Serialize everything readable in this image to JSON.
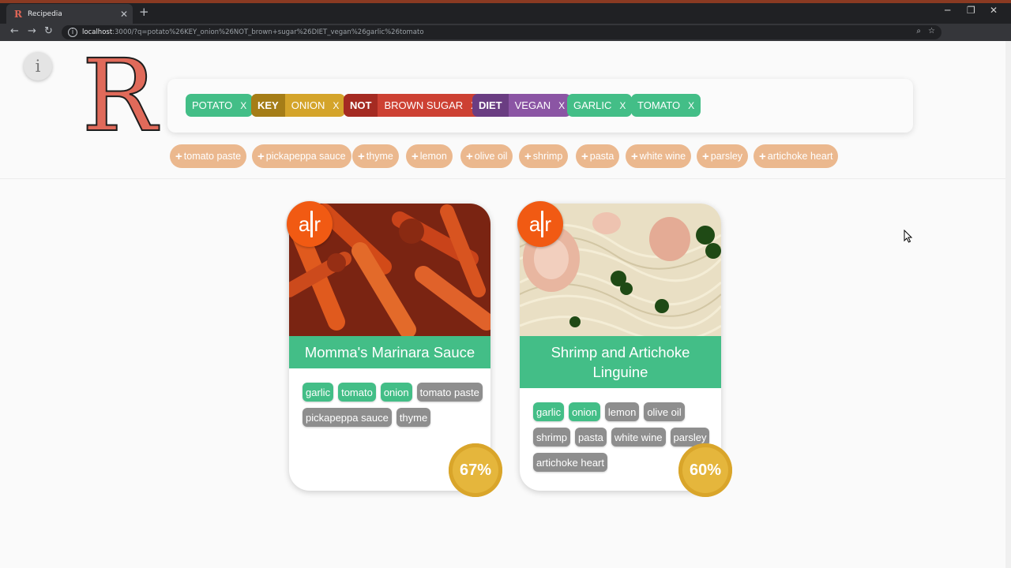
{
  "browser": {
    "tab_title": "Recipedia",
    "tab_favicon": "R",
    "url_host": "localhost",
    "url_rest": ":3000/?q=potato%26KEY_onion%26NOT_brown+sugar%26DIET_vegan%26garlic%26tomato"
  },
  "header": {
    "info_label": "i",
    "logo_letter": "R"
  },
  "search": {
    "chips": [
      {
        "prefix": "",
        "text": "POTATO",
        "remove": "X"
      },
      {
        "prefix": "KEY",
        "text": "ONION",
        "remove": "X"
      },
      {
        "prefix": "NOT",
        "text": "BROWN SUGAR",
        "remove": "X"
      },
      {
        "prefix": "DIET",
        "text": "VEGAN",
        "remove": "X"
      },
      {
        "prefix": "",
        "text": "GARLIC",
        "remove": "X"
      },
      {
        "prefix": "",
        "text": "TOMATO",
        "remove": "X"
      }
    ]
  },
  "suggestions": {
    "plus": "+",
    "items": [
      "tomato paste",
      "pickapeppa sauce",
      "thyme",
      "lemon",
      "olive oil",
      "shrimp",
      "pasta",
      "white wine",
      "parsley",
      "artichoke heart"
    ]
  },
  "recipes": [
    {
      "source": {
        "a": "a",
        "r": "r"
      },
      "title": "Momma's Marinara Sauce",
      "tags": [
        "garlic",
        "tomato",
        "onion",
        "tomato paste",
        "pickapeppa sauce",
        "thyme"
      ],
      "match_percent": "67%"
    },
    {
      "source": {
        "a": "a",
        "r": "r"
      },
      "title": "Shrimp and Artichoke Linguine",
      "tags": [
        "garlic",
        "onion",
        "lemon",
        "olive oil",
        "shrimp",
        "pasta",
        "white wine",
        "parsley",
        "artichoke heart"
      ],
      "match_percent": "60%"
    }
  ],
  "colors": {
    "match_green": "#43be87",
    "key_gold": "#d4a42a",
    "not_red": "#cd4133",
    "diet_purple": "#8b55a4",
    "suggestion_peach": "#ebb88e",
    "ar_orange": "#f15a13",
    "percent_gold": "#e5b63c",
    "missing_gray": "#8e8e8e"
  }
}
